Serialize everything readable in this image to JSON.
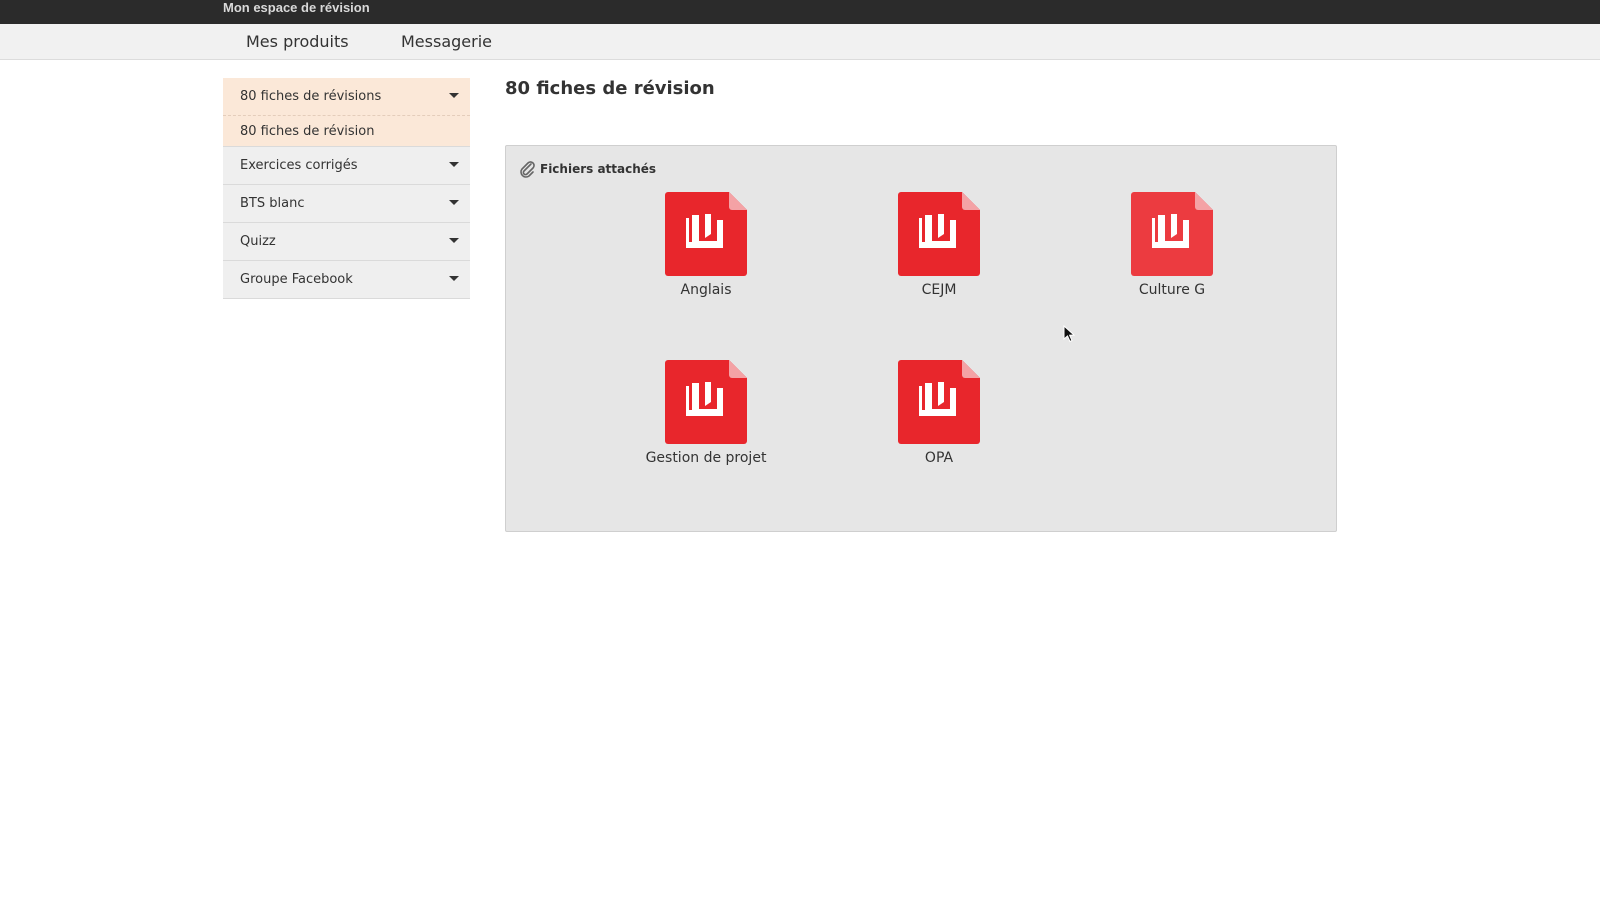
{
  "app": {
    "title": "Mon espace de révision"
  },
  "nav": {
    "items": [
      {
        "label": "Mes produits"
      },
      {
        "label": "Messagerie"
      }
    ]
  },
  "sidebar": {
    "items": [
      {
        "label": "80 fiches de révisions",
        "active": true,
        "sub": "80 fiches de révision"
      },
      {
        "label": "Exercices corrigés"
      },
      {
        "label": "BTS blanc"
      },
      {
        "label": "Quizz"
      },
      {
        "label": "Groupe Facebook"
      }
    ]
  },
  "main": {
    "title": "80 fiches de révision",
    "panel": {
      "title": "Fichiers attachés",
      "icon": "paperclip-icon",
      "files": [
        {
          "name": "Anglais",
          "icon": "pdf-file-icon"
        },
        {
          "name": "CEJM",
          "icon": "pdf-file-icon"
        },
        {
          "name": "Culture G",
          "icon": "pdf-file-icon"
        },
        {
          "name": "Gestion de projet",
          "icon": "pdf-file-icon"
        },
        {
          "name": "OPA",
          "icon": "pdf-file-icon"
        }
      ]
    }
  },
  "colors": {
    "pdf_red": "#e8262c",
    "active_bg": "#fbe8d8",
    "topbar": "#2b2b2b"
  }
}
